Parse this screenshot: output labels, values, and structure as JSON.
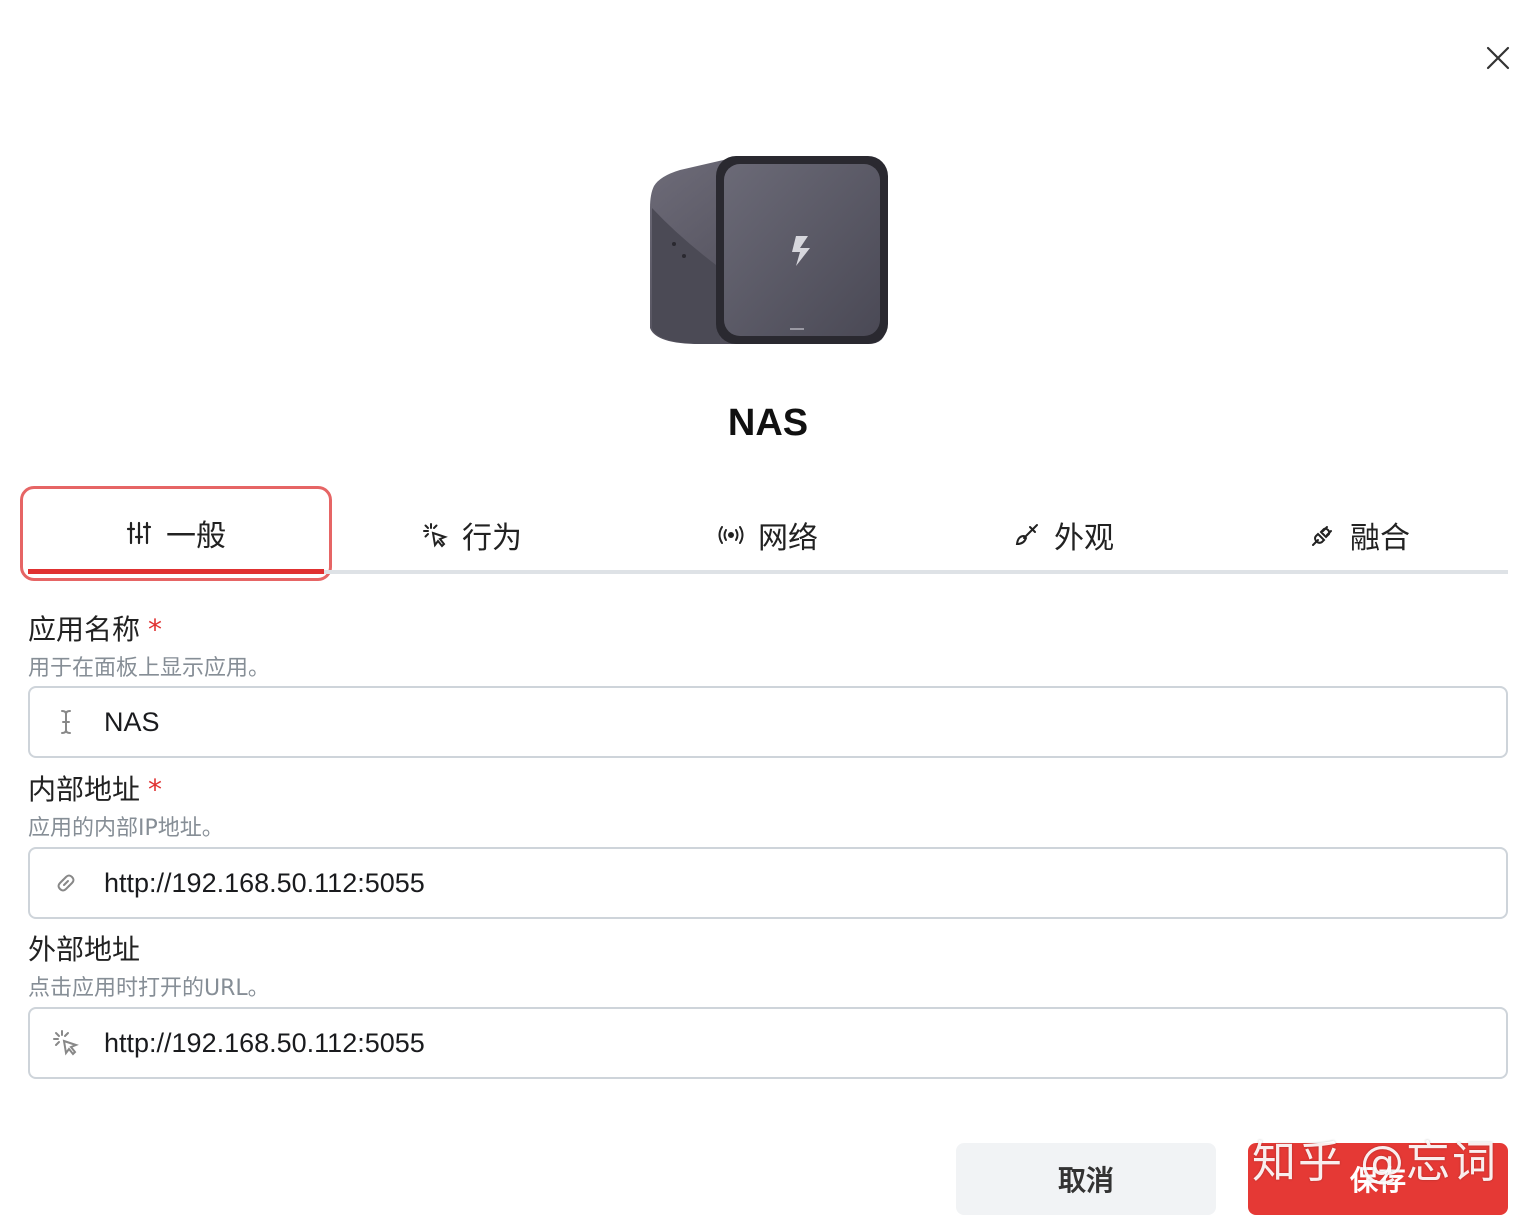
{
  "app": {
    "title": "NAS"
  },
  "tabs": [
    {
      "label": "一般",
      "icon": "sliders-icon",
      "active": true
    },
    {
      "label": "行为",
      "icon": "pointer-click-icon",
      "active": false
    },
    {
      "label": "网络",
      "icon": "broadcast-icon",
      "active": false
    },
    {
      "label": "外观",
      "icon": "brush-icon",
      "active": false
    },
    {
      "label": "融合",
      "icon": "plug-icon",
      "active": false
    }
  ],
  "fields": {
    "name": {
      "label": "应用名称",
      "required": "*",
      "description": "用于在面板上显示应用。",
      "value": "NAS",
      "icon": "cursor-text-icon"
    },
    "internal": {
      "label": "内部地址",
      "required": "*",
      "description": "应用的内部IP地址。",
      "value": "http://192.168.50.112:5055",
      "icon": "link-icon"
    },
    "external": {
      "label": "外部地址",
      "description": "点击应用时打开的URL。",
      "value": "http://192.168.50.112:5055",
      "icon": "pointer-click-icon"
    }
  },
  "buttons": {
    "cancel": "取消",
    "save": "保存"
  },
  "watermark": "知乎 @忘词",
  "colors": {
    "accent": "#e53935",
    "required": "#e03131",
    "muted": "#868e96"
  }
}
